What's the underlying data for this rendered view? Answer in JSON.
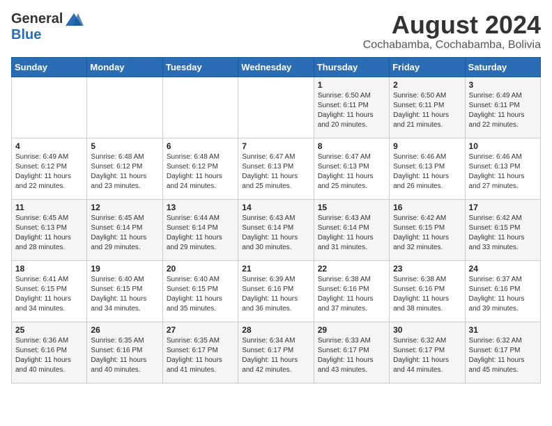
{
  "header": {
    "logo_general": "General",
    "logo_blue": "Blue",
    "month": "August 2024",
    "location": "Cochabamba, Cochabamba, Bolivia"
  },
  "days_of_week": [
    "Sunday",
    "Monday",
    "Tuesday",
    "Wednesday",
    "Thursday",
    "Friday",
    "Saturday"
  ],
  "weeks": [
    [
      {
        "day": "",
        "info": ""
      },
      {
        "day": "",
        "info": ""
      },
      {
        "day": "",
        "info": ""
      },
      {
        "day": "",
        "info": ""
      },
      {
        "day": "1",
        "info": "Sunrise: 6:50 AM\nSunset: 6:11 PM\nDaylight: 11 hours\nand 20 minutes."
      },
      {
        "day": "2",
        "info": "Sunrise: 6:50 AM\nSunset: 6:11 PM\nDaylight: 11 hours\nand 21 minutes."
      },
      {
        "day": "3",
        "info": "Sunrise: 6:49 AM\nSunset: 6:11 PM\nDaylight: 11 hours\nand 22 minutes."
      }
    ],
    [
      {
        "day": "4",
        "info": "Sunrise: 6:49 AM\nSunset: 6:12 PM\nDaylight: 11 hours\nand 22 minutes."
      },
      {
        "day": "5",
        "info": "Sunrise: 6:48 AM\nSunset: 6:12 PM\nDaylight: 11 hours\nand 23 minutes."
      },
      {
        "day": "6",
        "info": "Sunrise: 6:48 AM\nSunset: 6:12 PM\nDaylight: 11 hours\nand 24 minutes."
      },
      {
        "day": "7",
        "info": "Sunrise: 6:47 AM\nSunset: 6:13 PM\nDaylight: 11 hours\nand 25 minutes."
      },
      {
        "day": "8",
        "info": "Sunrise: 6:47 AM\nSunset: 6:13 PM\nDaylight: 11 hours\nand 25 minutes."
      },
      {
        "day": "9",
        "info": "Sunrise: 6:46 AM\nSunset: 6:13 PM\nDaylight: 11 hours\nand 26 minutes."
      },
      {
        "day": "10",
        "info": "Sunrise: 6:46 AM\nSunset: 6:13 PM\nDaylight: 11 hours\nand 27 minutes."
      }
    ],
    [
      {
        "day": "11",
        "info": "Sunrise: 6:45 AM\nSunset: 6:13 PM\nDaylight: 11 hours\nand 28 minutes."
      },
      {
        "day": "12",
        "info": "Sunrise: 6:45 AM\nSunset: 6:14 PM\nDaylight: 11 hours\nand 29 minutes."
      },
      {
        "day": "13",
        "info": "Sunrise: 6:44 AM\nSunset: 6:14 PM\nDaylight: 11 hours\nand 29 minutes."
      },
      {
        "day": "14",
        "info": "Sunrise: 6:43 AM\nSunset: 6:14 PM\nDaylight: 11 hours\nand 30 minutes."
      },
      {
        "day": "15",
        "info": "Sunrise: 6:43 AM\nSunset: 6:14 PM\nDaylight: 11 hours\nand 31 minutes."
      },
      {
        "day": "16",
        "info": "Sunrise: 6:42 AM\nSunset: 6:15 PM\nDaylight: 11 hours\nand 32 minutes."
      },
      {
        "day": "17",
        "info": "Sunrise: 6:42 AM\nSunset: 6:15 PM\nDaylight: 11 hours\nand 33 minutes."
      }
    ],
    [
      {
        "day": "18",
        "info": "Sunrise: 6:41 AM\nSunset: 6:15 PM\nDaylight: 11 hours\nand 34 minutes."
      },
      {
        "day": "19",
        "info": "Sunrise: 6:40 AM\nSunset: 6:15 PM\nDaylight: 11 hours\nand 34 minutes."
      },
      {
        "day": "20",
        "info": "Sunrise: 6:40 AM\nSunset: 6:15 PM\nDaylight: 11 hours\nand 35 minutes."
      },
      {
        "day": "21",
        "info": "Sunrise: 6:39 AM\nSunset: 6:16 PM\nDaylight: 11 hours\nand 36 minutes."
      },
      {
        "day": "22",
        "info": "Sunrise: 6:38 AM\nSunset: 6:16 PM\nDaylight: 11 hours\nand 37 minutes."
      },
      {
        "day": "23",
        "info": "Sunrise: 6:38 AM\nSunset: 6:16 PM\nDaylight: 11 hours\nand 38 minutes."
      },
      {
        "day": "24",
        "info": "Sunrise: 6:37 AM\nSunset: 6:16 PM\nDaylight: 11 hours\nand 39 minutes."
      }
    ],
    [
      {
        "day": "25",
        "info": "Sunrise: 6:36 AM\nSunset: 6:16 PM\nDaylight: 11 hours\nand 40 minutes."
      },
      {
        "day": "26",
        "info": "Sunrise: 6:35 AM\nSunset: 6:16 PM\nDaylight: 11 hours\nand 40 minutes."
      },
      {
        "day": "27",
        "info": "Sunrise: 6:35 AM\nSunset: 6:17 PM\nDaylight: 11 hours\nand 41 minutes."
      },
      {
        "day": "28",
        "info": "Sunrise: 6:34 AM\nSunset: 6:17 PM\nDaylight: 11 hours\nand 42 minutes."
      },
      {
        "day": "29",
        "info": "Sunrise: 6:33 AM\nSunset: 6:17 PM\nDaylight: 11 hours\nand 43 minutes."
      },
      {
        "day": "30",
        "info": "Sunrise: 6:32 AM\nSunset: 6:17 PM\nDaylight: 11 hours\nand 44 minutes."
      },
      {
        "day": "31",
        "info": "Sunrise: 6:32 AM\nSunset: 6:17 PM\nDaylight: 11 hours\nand 45 minutes."
      }
    ]
  ]
}
